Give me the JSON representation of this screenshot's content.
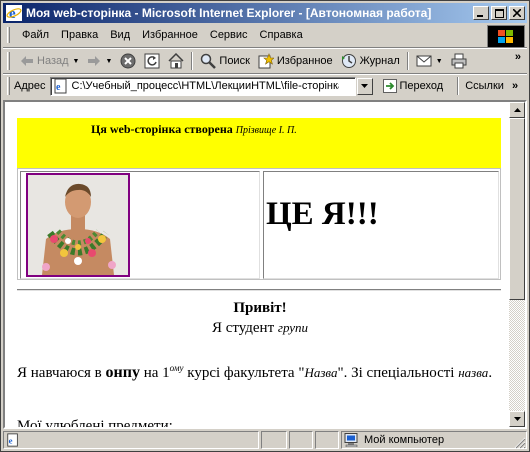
{
  "window": {
    "title": "Моя web-сторінка - Microsoft Internet Explorer - [Автономная работа]",
    "controls": {
      "minimize": "minimize-icon",
      "maximize": "maximize-icon",
      "close": "close-icon"
    }
  },
  "menubar": {
    "items": [
      {
        "label": "Файл"
      },
      {
        "label": "Правка"
      },
      {
        "label": "Вид"
      },
      {
        "label": "Избранное"
      },
      {
        "label": "Сервис"
      },
      {
        "label": "Справка"
      }
    ]
  },
  "toolbar": {
    "back_label": "Назад",
    "search_label": "Поиск",
    "favorites_label": "Избранное",
    "history_label": "Журнал",
    "more": "»"
  },
  "addressbar": {
    "label": "Адрес",
    "value": "C:\\Учебный_процесс\\HTML\\ЛекцииHTML\\file-сторінка.htm",
    "go_label": "Переход",
    "links_label": "Ссылки",
    "more": "»"
  },
  "page": {
    "banner_title": "Ця web-сторінка створена",
    "banner_author": "Прізвище І. П.",
    "heading": "ЦЕ Я!!!",
    "greeting": "Привіт!",
    "student_prefix": "Я студент",
    "student_group": "групи",
    "p1_a": "Я навчаюся в",
    "p1_b": "онпу",
    "p1_c": "на 1",
    "p1_sup": "ому",
    "p1_d": "курсі факультета \"",
    "p1_fac": "Назва",
    "p1_e": "\". Зі спеціальності",
    "p1_spec": "назва",
    "p1_end": ".",
    "favorites_heading": "Мої улюблені предмети:"
  },
  "statusbar": {
    "zone_label": "Мой компьютер"
  },
  "colors": {
    "titlebar_start": "#0a246a",
    "titlebar_end": "#a6caf0",
    "banner": "#ffff00",
    "photo_border": "#800080"
  }
}
